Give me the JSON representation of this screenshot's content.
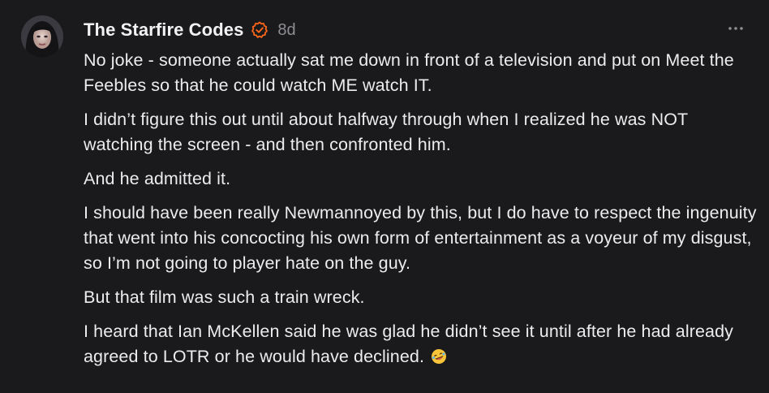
{
  "comment": {
    "author": "The Starfire Codes",
    "age": "8d",
    "verified_badge": "check-badge-icon",
    "more_menu_icon": "ellipsis-icon",
    "emoji": "rolling-on-floor-laughing-emoji",
    "paragraphs": [
      "No joke - someone actually sat me down in front of a television and put on Meet the Feebles so that he could watch ME watch IT.",
      "I didn’t figure this out until about halfway through when I realized he was NOT watching the screen - and then confronted him.",
      "And he admitted it.",
      "I should have been really Newmannoyed by this, but I do have to respect the ingenuity that went into his concocting his own form of entertainment as a voyeur of my disgust, so I’m not going to player hate on the guy.",
      "But that film was such a train wreck.",
      "I heard that Ian McKellen said he was glad he didn’t see it until after he had already agreed to LOTR or he would have declined."
    ]
  },
  "colors": {
    "background": "#1a1a1c",
    "text": "#ececee",
    "muted": "#8e8e93",
    "badge": "#ff6719"
  }
}
